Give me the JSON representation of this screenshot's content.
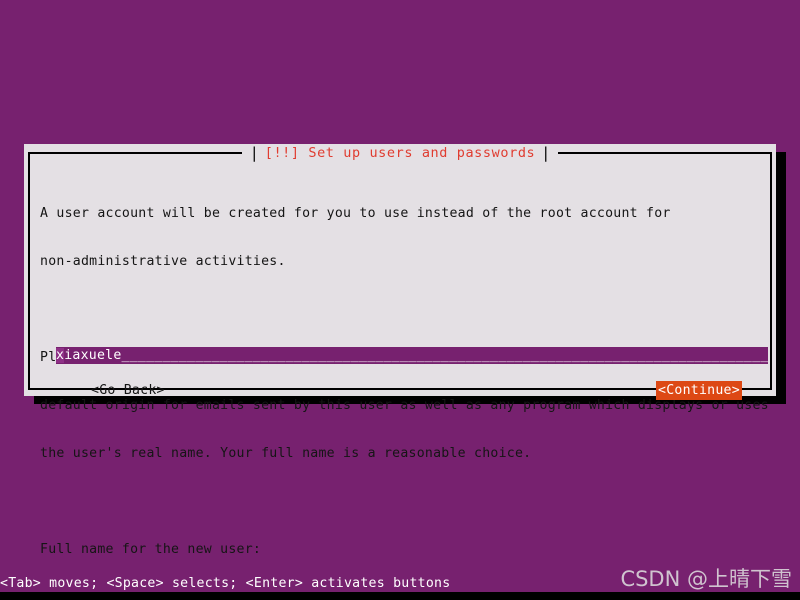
{
  "screen": {
    "background_color": "#77216f",
    "bottom_bar_color": "#000000"
  },
  "dialog": {
    "title": "[!!] Set up users and passwords",
    "title_color": "#e03c30",
    "background_color": "#e4e0e4",
    "border_color": "#000000",
    "title_separator_left": "|",
    "title_separator_right": "|",
    "paragraph1": [
      "A user account will be created for you to use instead of the root account for",
      "non-administrative activities."
    ],
    "paragraph2": [
      "Please enter the real name of this user. This information will be used for instance as",
      "default origin for emails sent by this user as well as any program which displays or uses",
      "the user's real name. Your full name is a reasonable choice."
    ],
    "field_label": "Full name for the new user:",
    "input": {
      "cursor_char": "x",
      "value_rest": "iaxuele",
      "value": "xiaxuele",
      "fill": "________________________________________________________________________________________________",
      "background_color": "#77216f",
      "cursor_color": "#8e3086",
      "text_color": "#ffffff"
    },
    "buttons": {
      "go_back": "<Go Back>",
      "continue": "<Continue>",
      "continue_background_color": "#dd4814",
      "continue_text_color": "#ffffff",
      "focused": "continue"
    }
  },
  "footer": {
    "hint": "<Tab> moves; <Space> selects; <Enter> activates buttons",
    "hint_color": "#ffffff"
  },
  "watermark": {
    "text": "CSDN @上晴下雪",
    "color": "#d8d2d8"
  }
}
